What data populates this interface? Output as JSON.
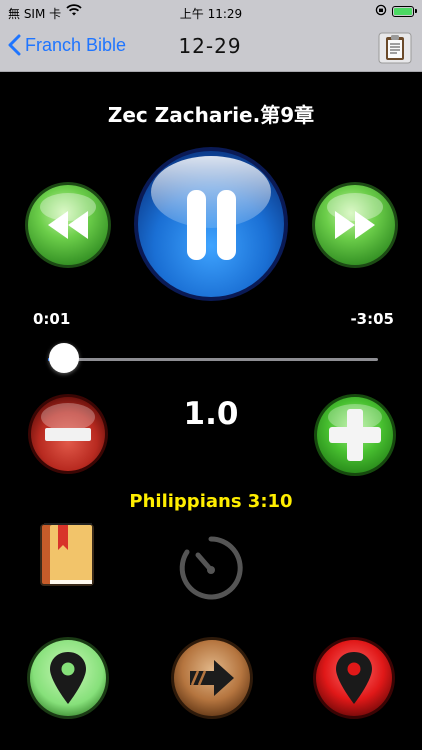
{
  "status_bar": {
    "carrier": "無 SIM 卡",
    "time": "上午 11:29"
  },
  "nav": {
    "back_label": "Franch Bible",
    "title": "12-29",
    "right_icon": "clipboard-icon"
  },
  "player": {
    "chapter_title": "Zec Zacharie.第9章",
    "elapsed": "0:01",
    "remaining": "-3:05",
    "progress_fraction": 0.005,
    "speed": "1.0",
    "verse_reference": "Philippians 3:10"
  },
  "colors": {
    "nav_background": "#c9c9ce",
    "link_blue": "#1f75ff",
    "verse_yellow": "#ffee00",
    "play_blue": "#1a6fd4",
    "green_orb": "#5cc24a",
    "red_orb": "#d83030"
  },
  "icons": [
    "rewind-icon",
    "pause-icon",
    "fast-forward-icon",
    "minus-icon",
    "plus-icon",
    "book-icon",
    "timer-icon",
    "green-pin-icon",
    "forward-arrow-icon",
    "red-pin-icon"
  ]
}
